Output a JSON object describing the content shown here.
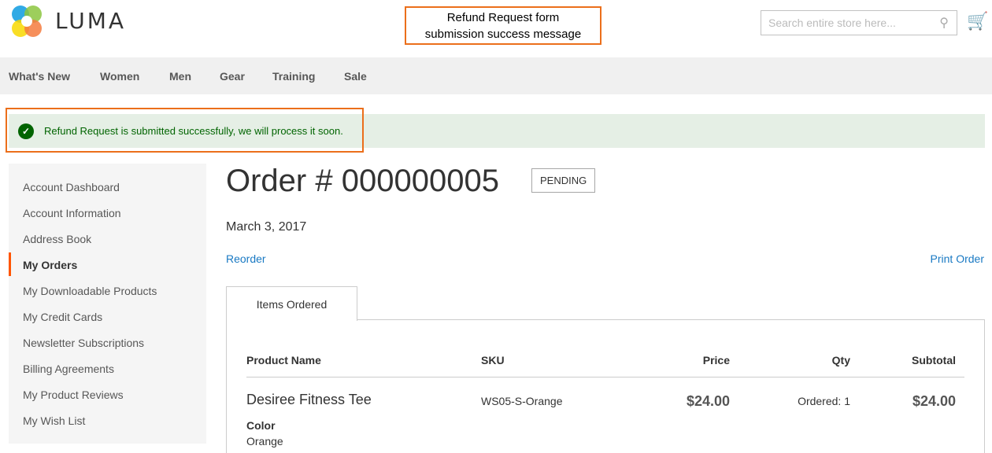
{
  "header": {
    "logo": "LUMA",
    "search_placeholder": "Search entire store here...",
    "annotation": "Refund Request form submission success message"
  },
  "nav": [
    "What's New",
    "Women",
    "Men",
    "Gear",
    "Training",
    "Sale"
  ],
  "message": "Refund Request is submitted successfully, we will process it soon.",
  "sidebar": [
    "Account Dashboard",
    "Account Information",
    "Address Book",
    "My Orders",
    "My Downloadable Products",
    "My Credit Cards",
    "Newsletter Subscriptions",
    "Billing Agreements",
    "My Product Reviews",
    "My Wish List"
  ],
  "order": {
    "title": "Order # 000000005",
    "status": "PENDING",
    "date": "March 3, 2017",
    "reorder": "Reorder",
    "print": "Print Order",
    "tab": "Items Ordered"
  },
  "table": {
    "headers": [
      "Product Name",
      "SKU",
      "Price",
      "Qty",
      "Subtotal"
    ],
    "rows": [
      {
        "name": "Desiree Fitness Tee",
        "sku": "WS05-S-Orange",
        "price": "$24.00",
        "qty": "Ordered: 1",
        "subtotal": "$24.00",
        "option_label": "Color",
        "option_value": "Orange"
      }
    ]
  },
  "colors": {
    "accent": "#eb6f1b",
    "success": "#006400",
    "link": "#1979c3"
  }
}
